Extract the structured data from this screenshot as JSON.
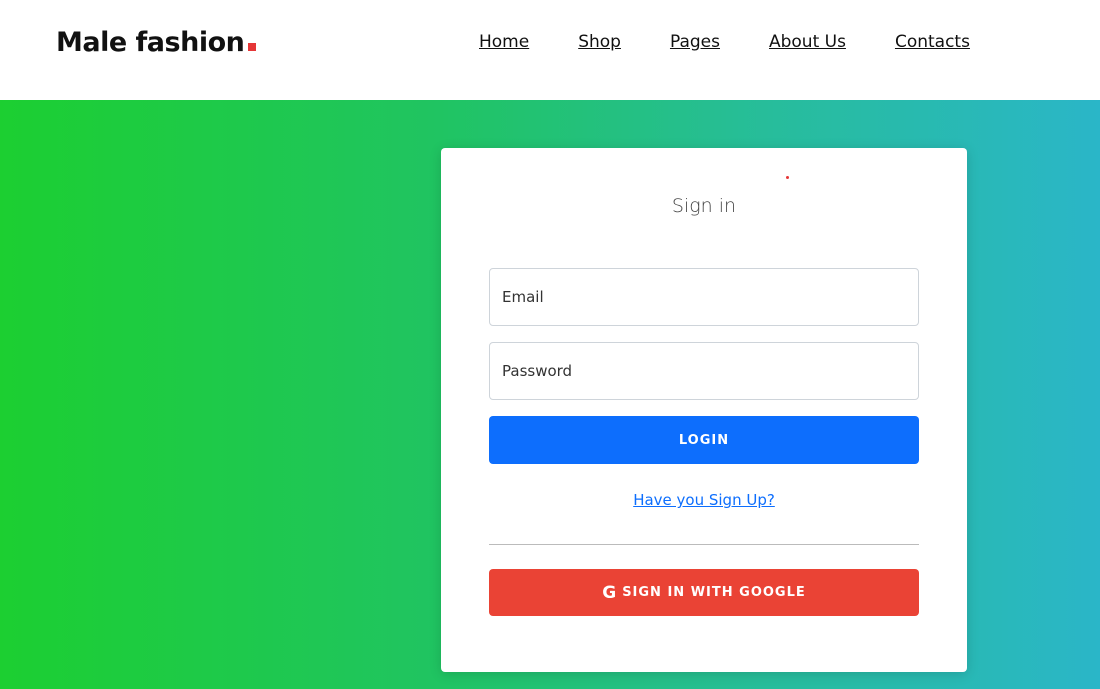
{
  "brand": {
    "name": "Male fashion",
    "accent_color": "#e53637"
  },
  "nav": {
    "items": [
      {
        "label": "Home"
      },
      {
        "label": "Shop"
      },
      {
        "label": "Pages"
      },
      {
        "label": "About Us"
      },
      {
        "label": "Contacts"
      }
    ]
  },
  "signin": {
    "title": "Sign in",
    "email_placeholder": "Email",
    "password_placeholder": "Password",
    "login_label": "LOGIN",
    "signup_link": "Have you Sign Up?",
    "google_icon": "google-g-icon",
    "google_label": "SIGN IN WITH GOOGLE"
  },
  "colors": {
    "login_button": "#0d6efd",
    "google_button": "#ea4335",
    "gradient_start": "#1ccf31",
    "gradient_end": "#2ab6c8"
  }
}
